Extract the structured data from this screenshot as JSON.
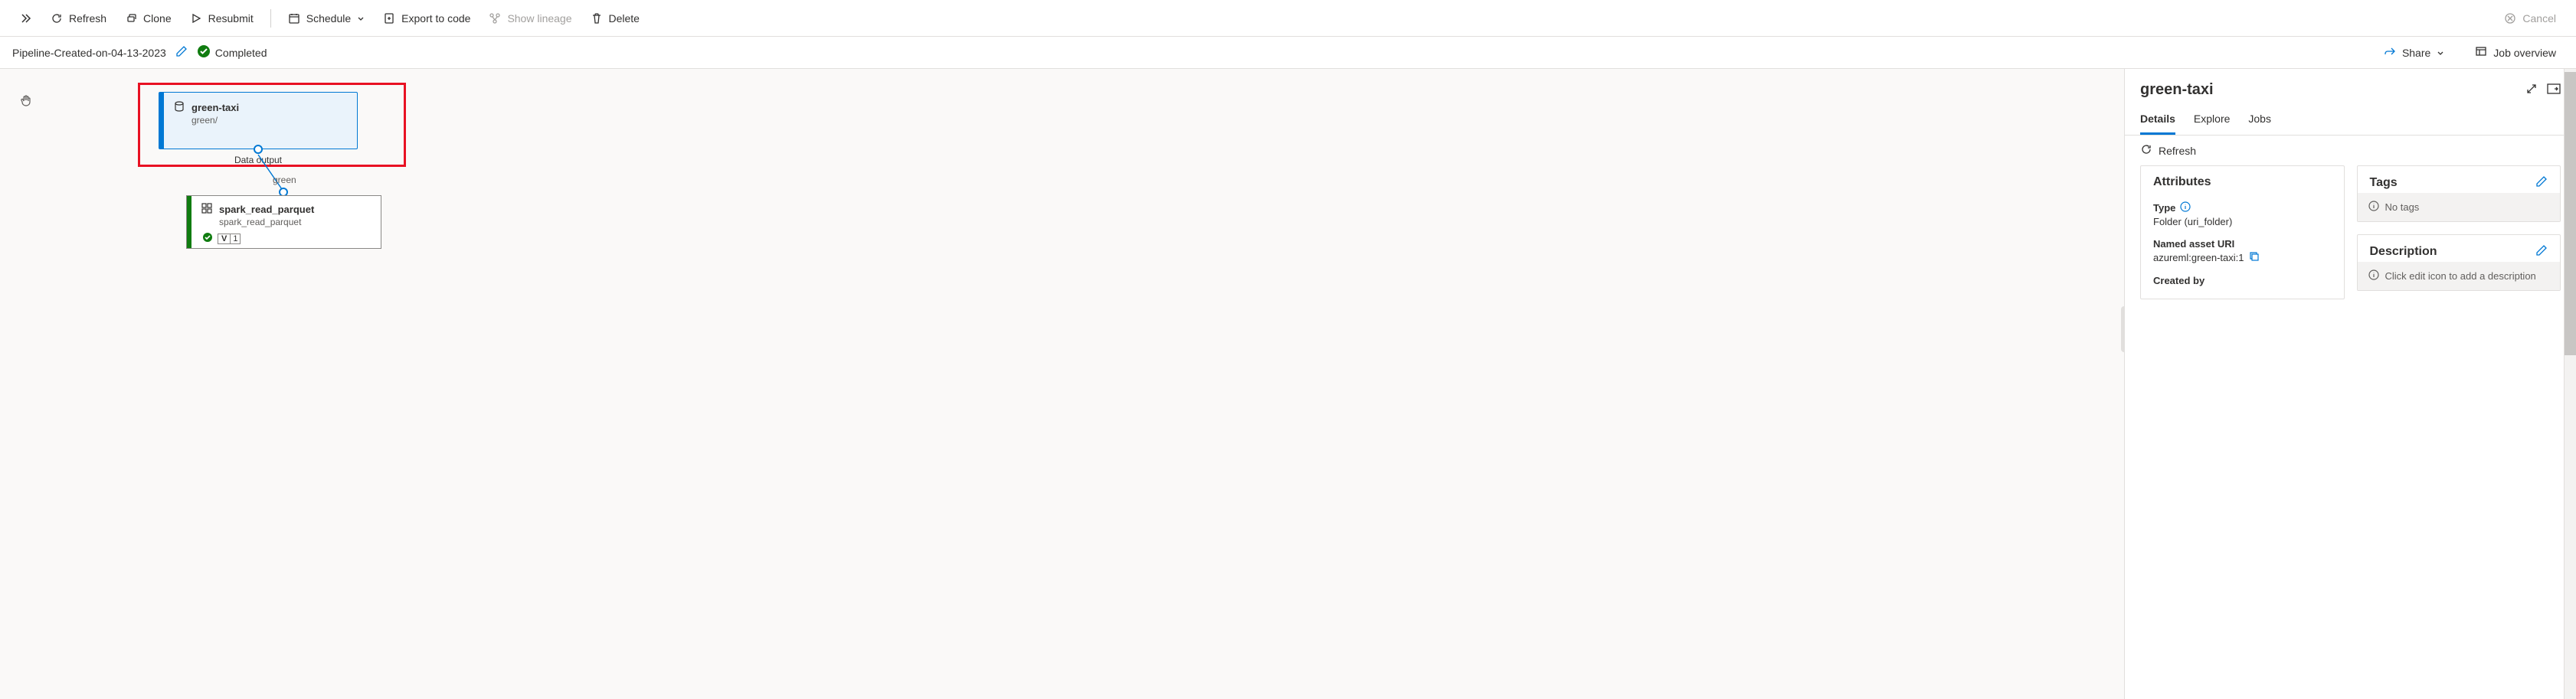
{
  "toolbar": {
    "refresh": "Refresh",
    "clone": "Clone",
    "resubmit": "Resubmit",
    "schedule": "Schedule",
    "export": "Export to code",
    "lineage": "Show lineage",
    "delete": "Delete",
    "cancel": "Cancel"
  },
  "pipeline": {
    "name": "Pipeline-Created-on-04-13-2023",
    "status": "Completed"
  },
  "subheader_actions": {
    "share": "Share",
    "overview": "Job overview"
  },
  "canvas": {
    "node1": {
      "title": "green-taxi",
      "subtitle": "green/",
      "port_label": "Data output"
    },
    "edge_label": "green",
    "node2": {
      "title": "spark_read_parquet",
      "subtitle": "spark_read_parquet",
      "version_key": "V",
      "version_val": "1"
    }
  },
  "panel": {
    "title": "green-taxi",
    "tabs": {
      "details": "Details",
      "explore": "Explore",
      "jobs": "Jobs"
    },
    "refresh": "Refresh",
    "attributes": {
      "heading": "Attributes",
      "type_label": "Type",
      "type_value": "Folder (uri_folder)",
      "uri_label": "Named asset URI",
      "uri_value": "azureml:green-taxi:1",
      "created_by_label": "Created by"
    },
    "tags": {
      "heading": "Tags",
      "empty": "No tags"
    },
    "description": {
      "heading": "Description",
      "empty": "Click edit icon to add a description"
    }
  }
}
